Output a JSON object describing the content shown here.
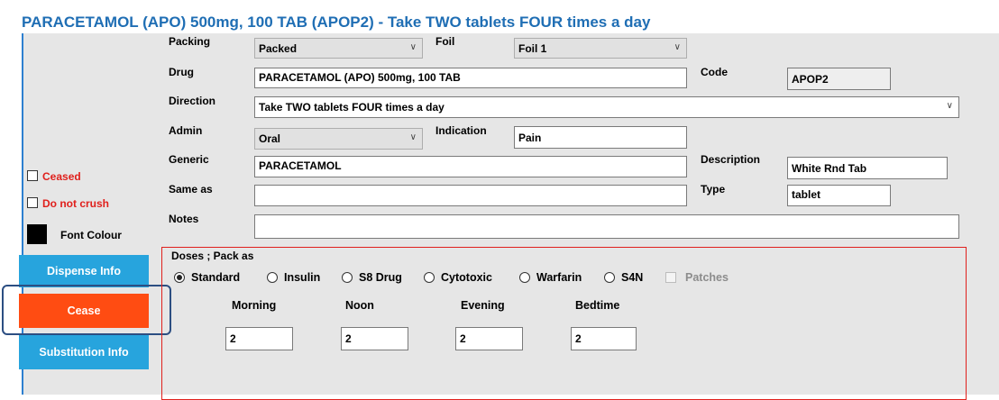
{
  "header": {
    "title": "PARACETAMOL (APO) 500mg, 100 TAB (APOP2) - Take TWO tablets FOUR times a day"
  },
  "form": {
    "packing_label": "Packing",
    "packing_value": "Packed",
    "foil_label": "Foil",
    "foil_value": "Foil 1",
    "drug_label": "Drug",
    "drug_value": "PARACETAMOL (APO) 500mg, 100 TAB",
    "code_label": "Code",
    "code_value": "APOP2",
    "direction_label": "Direction",
    "direction_value": "Take TWO tablets FOUR times a day",
    "admin_label": "Admin",
    "admin_value": "Oral",
    "indication_label": "Indication",
    "indication_value": "Pain",
    "generic_label": "Generic",
    "generic_value": "PARACETAMOL",
    "description_label": "Description",
    "description_value": "White Rnd Tab",
    "sameas_label": "Same as",
    "sameas_value": "",
    "type_label": "Type",
    "type_value": "tablet",
    "notes_label": "Notes",
    "notes_value": ""
  },
  "sidebar": {
    "ceased_label": "Ceased",
    "do_not_crush_label": "Do not crush",
    "font_colour_label": "Font Colour",
    "font_colour_swatch": "#000000",
    "dispense_info_label": "Dispense Info",
    "cease_label": "Cease",
    "substitution_info_label": "Substitution Info"
  },
  "doses": {
    "section_label": "Doses ; Pack as",
    "pack_options": [
      {
        "label": "Standard",
        "selected": true
      },
      {
        "label": "Insulin",
        "selected": false
      },
      {
        "label": "S8 Drug",
        "selected": false
      },
      {
        "label": "Cytotoxic",
        "selected": false
      },
      {
        "label": "Warfarin",
        "selected": false
      },
      {
        "label": "S4N",
        "selected": false
      }
    ],
    "patches_label": "Patches",
    "times": [
      {
        "label": "Morning",
        "value": "2"
      },
      {
        "label": "Noon",
        "value": "2"
      },
      {
        "label": "Evening",
        "value": "2"
      },
      {
        "label": "Bedtime",
        "value": "2"
      }
    ]
  },
  "colors": {
    "title": "#1f6eb4",
    "panel": "#e6e6e6",
    "button_blue": "#27a4dd",
    "button_orange": "#ff4c12",
    "alert_red": "#e0201c",
    "highlight_ring": "#2c4e82"
  }
}
